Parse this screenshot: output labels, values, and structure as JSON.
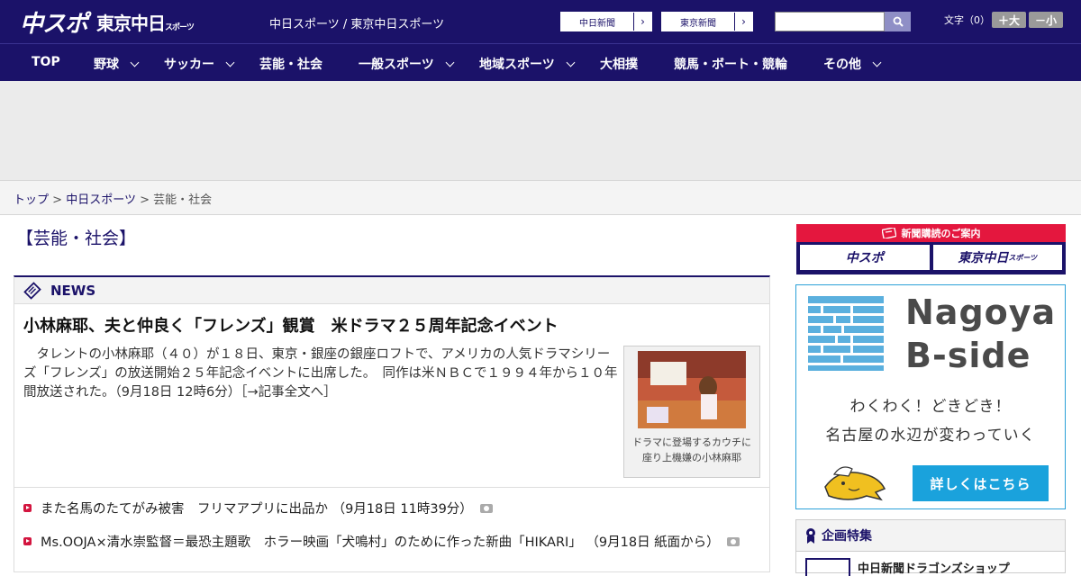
{
  "header": {
    "logo_primary": "中スポ",
    "logo_secondary": "東京中日",
    "logo_secondary_small": "スポーツ",
    "tagline": "中日スポーツ / 東京中日スポーツ",
    "paper_links": [
      {
        "label": "中日新聞"
      },
      {
        "label": "東京新聞"
      }
    ],
    "search": {
      "placeholder": "",
      "value": ""
    },
    "font_size_label": "文字（0）",
    "font_bigger": "＋大",
    "font_smaller": "－小"
  },
  "nav": {
    "items": [
      {
        "label": "TOP",
        "has_menu": false
      },
      {
        "label": "野球",
        "has_menu": true
      },
      {
        "label": "サッカー",
        "has_menu": true
      },
      {
        "label": "芸能・社会",
        "has_menu": false
      },
      {
        "label": "一般スポーツ",
        "has_menu": true
      },
      {
        "label": "地域スポーツ",
        "has_menu": true
      },
      {
        "label": "大相撲",
        "has_menu": false
      },
      {
        "label": "競馬・ボート・競輪",
        "has_menu": false
      },
      {
        "label": "その他",
        "has_menu": true
      }
    ]
  },
  "breadcrumb": {
    "items": [
      "トップ",
      "中日スポーツ",
      "芸能・社会"
    ],
    "separator": ">"
  },
  "page": {
    "section_title": "【芸能・社会】"
  },
  "news": {
    "header_label": "NEWS",
    "top_story": {
      "headline": "小林麻耶、夫と仲良く「フレンズ」観賞　米ドラマ２５周年記念イベント",
      "lead": "タレントの小林麻耶（４０）が１８日、東京・銀座の銀座ロフトで、アメリカの人気ドラマシリーズ「フレンズ」の放送開始２５年記念イベントに出席した。　同作は米ＮＢＣで１９９４年から１０年間放送された。（9月18日 12時6分）［→記事全文へ］",
      "photo_caption": "ドラマに登場するカウチに座り上機嫌の小林麻耶"
    },
    "items": [
      {
        "text": "また名馬のたてがみ被害　フリマアプリに出品か （9月18日 11時39分）"
      },
      {
        "text": "Ms.OOJA×清水崇監督＝最恐主題歌　ホラー映画「犬鳴村」のために作った新曲「HIKARI」 （9月18日 紙面から）"
      }
    ]
  },
  "sidebar": {
    "subscribe_label": "新聞購読のご案内",
    "subscribe_tiles": [
      "中スポ",
      "東京中日"
    ],
    "subscribe_tile_small": "スポーツ",
    "bside": {
      "title_line1": "Nagoya",
      "title_line2": "B-side",
      "sub1": "わくわく！どきどき！",
      "sub2": "名古屋の水辺が変わっていく",
      "cta": "詳しくはこちら"
    },
    "feature": {
      "label": "企画特集",
      "first_item": "中日新聞ドラゴンズショップ"
    }
  },
  "colors": {
    "brand_navy": "#1b1269",
    "accent_red": "#e4173e",
    "bside_blue": "#1aa2dc"
  }
}
